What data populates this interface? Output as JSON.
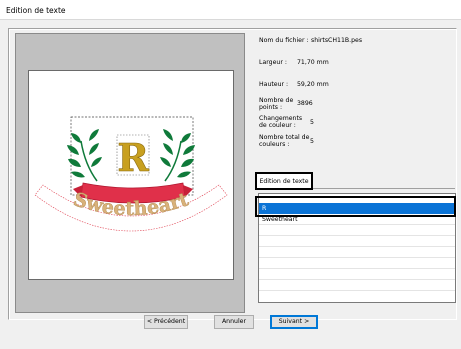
{
  "window": {
    "title": "Edition de texte"
  },
  "info": {
    "filename_label": "Nom du fichier :",
    "filename_value": "shirtsCH11B.pes",
    "width_label": "Largeur :",
    "width_value": "71,70   mm",
    "height_label": "Hauteur :",
    "height_value": "59,20   mm",
    "points_label_1": "Nombre de",
    "points_label_2": "points :",
    "points_value": "3896",
    "color_changes_label_1": "Changements",
    "color_changes_label_2": "de couleur :",
    "color_changes_value": "5",
    "total_colors_label_1": "Nombre total de",
    "total_colors_label_2": "couleurs :",
    "total_colors_value": "5"
  },
  "design": {
    "monogram": "R",
    "banner_text": "Sweetheart"
  },
  "tab": {
    "label": "Edition de texte"
  },
  "text_list": {
    "items": [
      "R",
      "Sweetheart"
    ],
    "selected_index": 0
  },
  "buttons": {
    "back": "< Précédent",
    "cancel": "Annuler",
    "next": "Suivant >"
  },
  "colors": {
    "selection": "#0a73d6",
    "laurel_green": "#0f7a3a",
    "monogram_gold": "#c8a020",
    "banner_red": "#e0304a",
    "banner_text": "#d9b27a"
  }
}
